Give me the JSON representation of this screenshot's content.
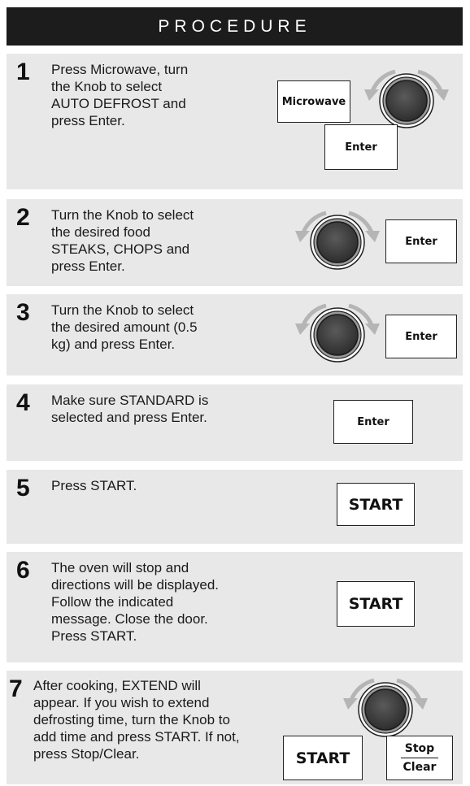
{
  "header": {
    "title": "PROCEDURE"
  },
  "steps": [
    {
      "number": "1",
      "text": "Press Microwave, turn\nthe Knob to select\nAUTO DEFROST and\npress Enter.",
      "buttons": [
        "Microwave",
        "Enter"
      ],
      "knob_icon": "rotary-knob-icon"
    },
    {
      "number": "2",
      "text": "Turn the Knob to select\nthe desired food\nSTEAKS, CHOPS and\npress Enter.",
      "buttons": [
        "Enter"
      ],
      "knob_icon": "rotary-knob-icon"
    },
    {
      "number": "3",
      "text": "Turn the Knob to select\nthe desired amount (0.5\nkg) and press Enter.",
      "buttons": [
        "Enter"
      ],
      "knob_icon": "rotary-knob-icon"
    },
    {
      "number": "4",
      "text": "Make sure STANDARD is\nselected and press Enter.",
      "buttons": [
        "Enter"
      ]
    },
    {
      "number": "5",
      "text": "Press START.",
      "buttons": [
        "START"
      ]
    },
    {
      "number": "6",
      "text": "The oven will stop and\ndirections will be displayed.\nFollow the indicated\nmessage. Close the door.\nPress START.",
      "buttons": [
        "START"
      ]
    },
    {
      "number": "7",
      "text": "After cooking, EXTEND will\nappear. If you wish to extend\ndefrosting time, turn the Knob to\nadd time and press START. If not,\npress Stop/Clear.",
      "buttons": [
        "START"
      ],
      "stop_clear": {
        "top": "Stop",
        "bottom": "Clear"
      },
      "knob_icon": "rotary-knob-icon"
    }
  ],
  "colors": {
    "header_bg": "#1c1c1c",
    "step_bg": "#e8e8e8",
    "knob_dark": "#3c3c3c",
    "arrow": "#b5b5b5"
  }
}
